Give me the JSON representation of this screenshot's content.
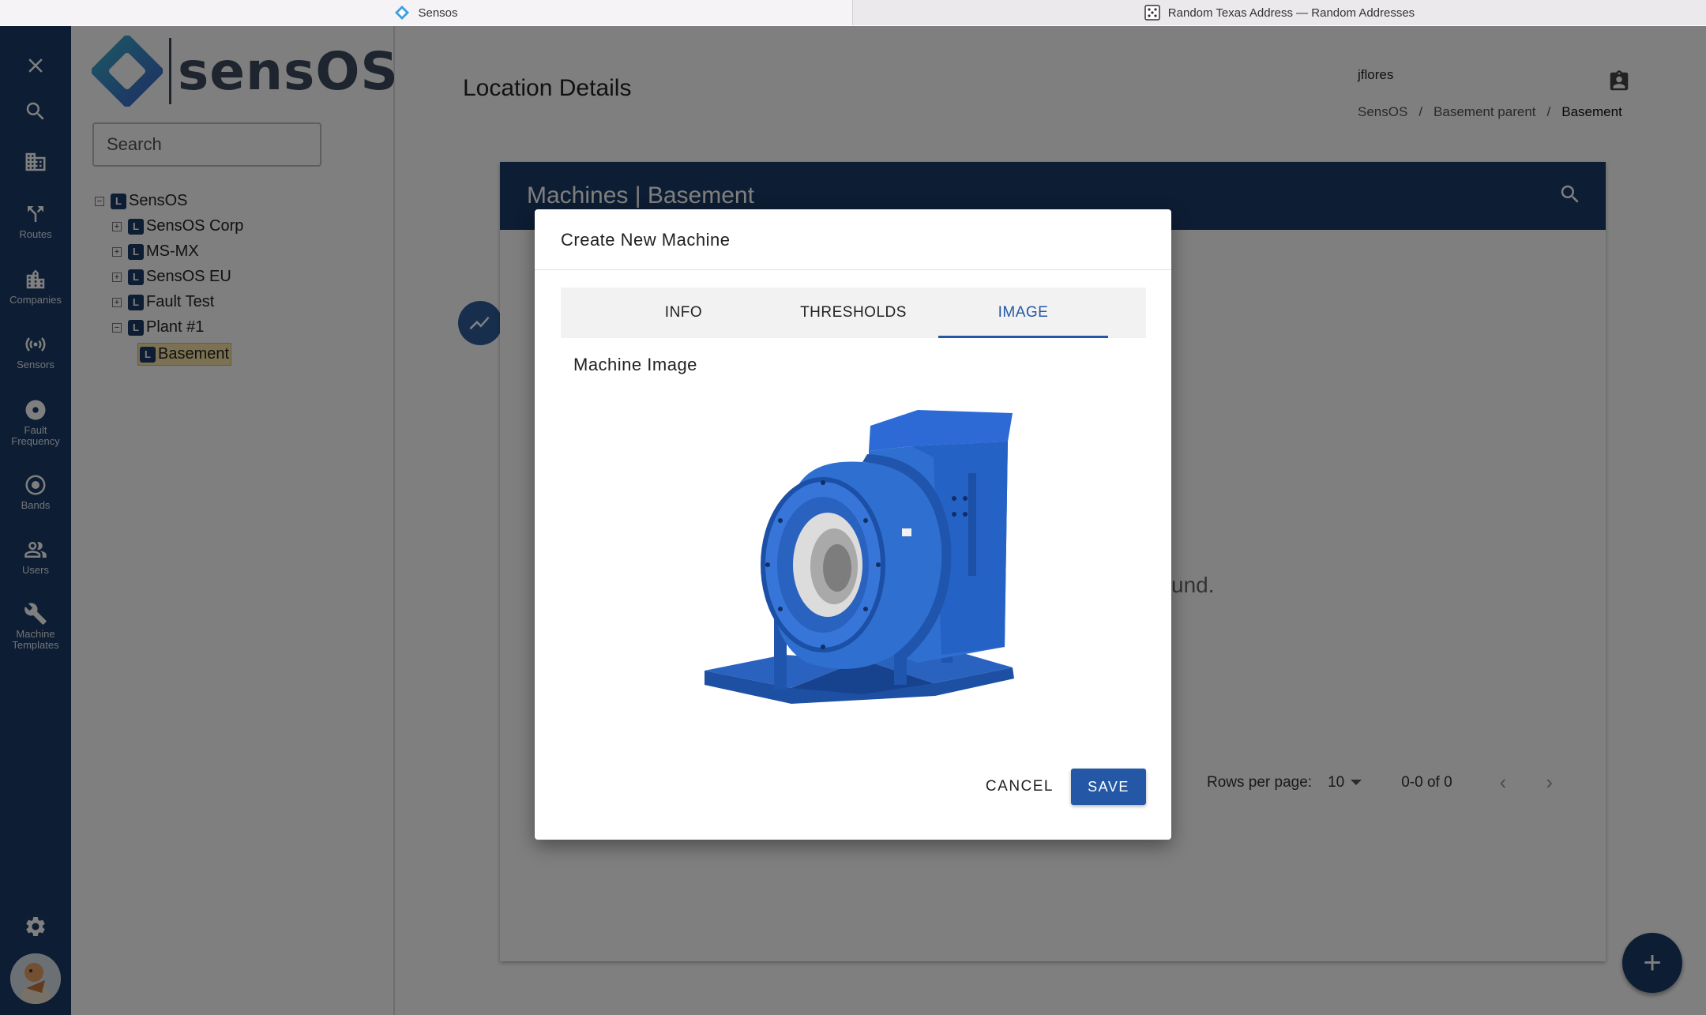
{
  "browser": {
    "tabs": [
      {
        "title": "Sensos",
        "active": true
      },
      {
        "title": "Random Texas Address — Random Addresses",
        "active": false
      }
    ]
  },
  "rail": {
    "items": [
      {
        "label": "",
        "icon": "close-icon"
      },
      {
        "label": "",
        "icon": "search-icon"
      },
      {
        "label": "",
        "icon": "building-icon"
      },
      {
        "label": "Routes",
        "icon": "routes-icon"
      },
      {
        "label": "Companies",
        "icon": "companies-icon"
      },
      {
        "label": "Sensors",
        "icon": "sensors-icon"
      },
      {
        "label": "Fault Frequency",
        "icon": "fault-frequency-icon"
      },
      {
        "label": "Bands",
        "icon": "bands-icon"
      },
      {
        "label": "Users",
        "icon": "users-icon"
      },
      {
        "label": "Machine Templates",
        "icon": "wrench-icon"
      }
    ],
    "settings_icon": "gear-icon",
    "avatar_icon": "avatar"
  },
  "sidebar": {
    "logo_text": "sensOS",
    "search_placeholder": "Search",
    "tree": [
      {
        "label": "SensOS",
        "badge": "L",
        "toggle": "−",
        "level": 0
      },
      {
        "label": "SensOS Corp",
        "badge": "L",
        "toggle": "+",
        "level": 1
      },
      {
        "label": "MS-MX",
        "badge": "L",
        "toggle": "+",
        "level": 1
      },
      {
        "label": "SensOS EU",
        "badge": "L",
        "toggle": "+",
        "level": 1
      },
      {
        "label": "Fault Test",
        "badge": "L",
        "toggle": "+",
        "level": 1
      },
      {
        "label": "Plant #1",
        "badge": "L",
        "toggle": "−",
        "level": 1
      },
      {
        "label": "Basement",
        "badge": "L",
        "toggle": "",
        "level": 2,
        "selected": true
      }
    ]
  },
  "header": {
    "title": "Location Details",
    "user": "jflores",
    "breadcrumb": [
      "SensOS",
      "Basement parent",
      "Basement"
    ],
    "separator": "/"
  },
  "card": {
    "title": "Machines | Basement",
    "empty_text": "und.",
    "pager": {
      "rows_label": "Rows per page:",
      "rows_value": "10",
      "range": "0-0 of 0",
      "prev": "‹",
      "next": "›"
    }
  },
  "fab": {
    "add_label": "+"
  },
  "dialog": {
    "title": "Create New Machine",
    "tabs": [
      "INFO",
      "THRESHOLDS",
      "IMAGE"
    ],
    "active_tab": "IMAGE",
    "section_label": "Machine Image",
    "cancel_label": "CANCEL",
    "save_label": "SAVE"
  },
  "colors": {
    "navy": "#1b3a67",
    "accent_blue": "#2458a6",
    "machine_blue": "#2f6fd0"
  }
}
